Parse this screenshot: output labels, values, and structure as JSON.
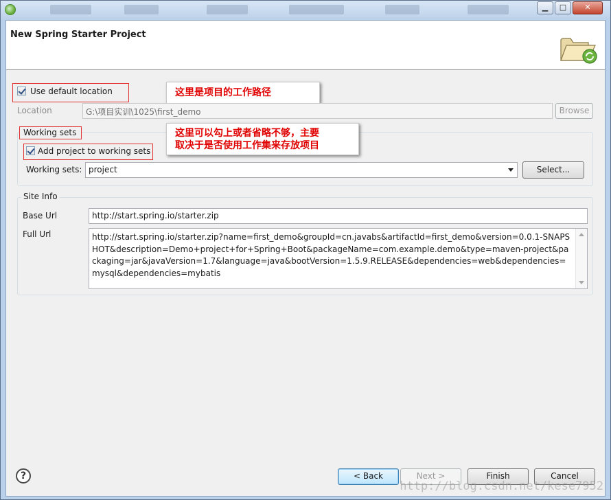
{
  "window": {
    "header_title": "New Spring Starter Project",
    "controls": {
      "minimize": "▁",
      "maximize": "□",
      "close": "✕"
    }
  },
  "location": {
    "use_default_label": "Use default location",
    "use_default_checked": true,
    "label": "Location",
    "value": "G:\\项目实训\\1025\\first_demo",
    "browse_label": "Browse"
  },
  "working_sets": {
    "group_title": "Working sets",
    "add_label": "Add project to working sets",
    "add_checked": true,
    "sets_label": "Working sets:",
    "selected": "project",
    "select_label": "Select..."
  },
  "site_info": {
    "group_title": "Site Info",
    "base_url_label": "Base Url",
    "base_url": "http://start.spring.io/starter.zip",
    "full_url_label": "Full Url",
    "full_url": "http://start.spring.io/starter.zip?name=first_demo&groupId=cn.javabs&artifactId=first_demo&version=0.0.1-SNAPSHOT&description=Demo+project+for+Spring+Boot&packageName=com.example.demo&type=maven-project&packaging=jar&javaVersion=1.7&language=java&bootVersion=1.5.9.RELEASE&dependencies=web&dependencies=mysql&dependencies=mybatis"
  },
  "annotations": {
    "location_note": "这里是项目的工作路径",
    "working_sets_note_line1": "这里可以勾上或者省略不够，主要",
    "working_sets_note_line2": "取决于是否使用工作集来存放项目"
  },
  "footer": {
    "help": "?",
    "back_label": "< Back",
    "next_label": "Next >",
    "finish_label": "Finish",
    "cancel_label": "Cancel"
  },
  "watermark": "http://blog.csdn.net/kese7952",
  "icons": [
    "spring-logo-icon",
    "folder-spring-icon",
    "help-icon",
    "combo-arrow-icon",
    "scroll-up-icon",
    "scroll-down-icon"
  ]
}
